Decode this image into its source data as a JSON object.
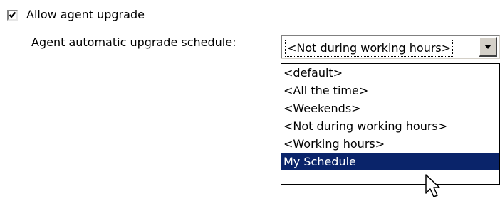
{
  "upgrade": {
    "allow_label": "Allow agent upgrade",
    "allow_checked": true,
    "schedule_label": "Agent automatic upgrade schedule:",
    "selected_value": "<Not during working hours>",
    "options": [
      "<default>",
      "<All the time>",
      "<Weekends>",
      "<Not during working hours>",
      "<Working hours>",
      "My Schedule"
    ],
    "highlighted_option": "My Schedule"
  },
  "icons": {
    "checkbox": "check-icon",
    "dropdown": "chevron-down-icon",
    "cursor": "mouse-pointer-icon"
  },
  "colors": {
    "highlight_bg": "#0a246a",
    "highlight_fg": "#ffffff",
    "button_face": "#d4d0c8"
  }
}
